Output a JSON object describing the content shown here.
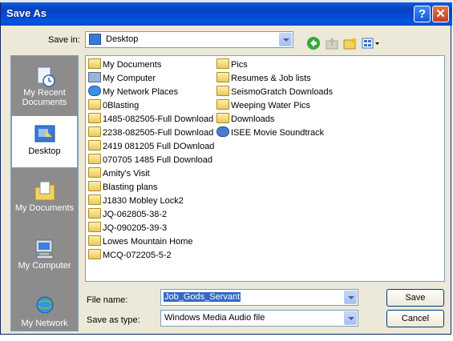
{
  "window": {
    "title": "Save As",
    "help_label": "?",
    "close_label": "✕"
  },
  "save_in": {
    "label": "Save in:",
    "value": "Desktop"
  },
  "places": [
    {
      "label": "My Recent Documents",
      "icon": "recent-documents-icon"
    },
    {
      "label": "Desktop",
      "icon": "desktop-icon",
      "selected": true
    },
    {
      "label": "My Documents",
      "icon": "my-documents-icon"
    },
    {
      "label": "My Computer",
      "icon": "my-computer-icon"
    },
    {
      "label": "My Network",
      "icon": "my-network-icon"
    }
  ],
  "files": {
    "column1": [
      {
        "name": "My Documents",
        "icon": "my-documents-icon"
      },
      {
        "name": "My Computer",
        "icon": "my-computer-icon"
      },
      {
        "name": "My Network Places",
        "icon": "network-places-icon"
      },
      {
        "name": "0Blasting",
        "icon": "folder-icon"
      },
      {
        "name": "1485-082505-Full Download",
        "icon": "folder-icon"
      },
      {
        "name": "2238-082505-Full Download",
        "icon": "folder-icon"
      },
      {
        "name": "2419 081205 Full DOwnload",
        "icon": "folder-icon"
      },
      {
        "name": "070705 1485 Full Download",
        "icon": "folder-icon"
      },
      {
        "name": "Amity's Visit",
        "icon": "folder-icon"
      },
      {
        "name": "Blasting plans",
        "icon": "folder-icon"
      },
      {
        "name": "J1830 Mobley Lock2",
        "icon": "folder-icon"
      },
      {
        "name": "JQ-062805-38-2",
        "icon": "folder-icon"
      },
      {
        "name": "JQ-090205-39-3",
        "icon": "folder-icon"
      },
      {
        "name": "Lowes Mountain Home",
        "icon": "folder-icon"
      },
      {
        "name": "MCQ-072205-5-2",
        "icon": "folder-icon"
      }
    ],
    "column2": [
      {
        "name": "Pics",
        "icon": "folder-icon"
      },
      {
        "name": "Resumes & Job lists",
        "icon": "folder-icon"
      },
      {
        "name": "SeismoGratch Downloads",
        "icon": "folder-icon"
      },
      {
        "name": "Weeping Water Pics",
        "icon": "folder-icon"
      },
      {
        "name": "Downloads",
        "icon": "shortcut-folder-icon"
      },
      {
        "name": "ISEE Movie Soundtrack",
        "icon": "media-file-icon"
      }
    ]
  },
  "file_name": {
    "label": "File name:",
    "value": "Job_Gods_Servant"
  },
  "save_as_type": {
    "label": "Save as type:",
    "value": "Windows Media Audio file"
  },
  "buttons": {
    "save": "Save",
    "cancel": "Cancel"
  },
  "colors": {
    "title_bar": "#0a4fd6",
    "places_bg": "#8c8c8c",
    "selection": "#316ac5"
  }
}
